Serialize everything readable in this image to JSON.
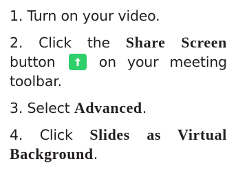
{
  "steps": [
    {
      "text": "1. Turn on your video."
    },
    {
      "pre": "2. Click the ",
      "bold": "Share Screen",
      "mid": "button",
      "post": " on your meeting toolbar."
    },
    {
      "pre": "3. Select ",
      "bold": "Advanced",
      "post": "."
    },
    {
      "pre": "4. Click ",
      "bold": "Slides as Virtual Background",
      "post": "."
    }
  ],
  "icons": {
    "share_screen": "share-screen-up-arrow-icon"
  },
  "colors": {
    "share_button": "#2fcf6c",
    "text": "#231f20"
  }
}
